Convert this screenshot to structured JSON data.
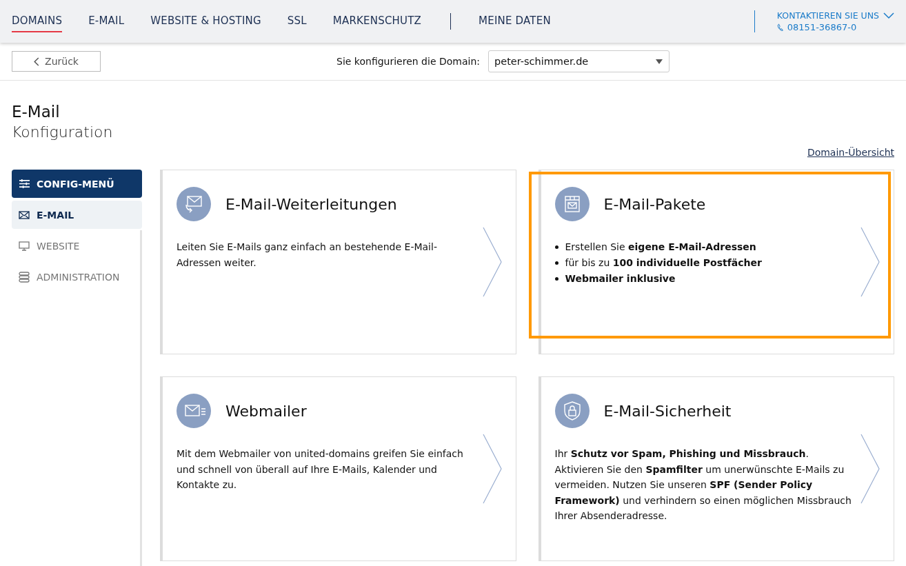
{
  "nav": {
    "items": [
      {
        "label": "DOMAINS",
        "selected": true
      },
      {
        "label": "E-MAIL",
        "selected": false
      },
      {
        "label": "WEBSITE & HOSTING",
        "selected": false
      },
      {
        "label": "SSL",
        "selected": false
      },
      {
        "label": "MARKENSCHUTZ",
        "selected": false
      }
    ],
    "account": "MEINE DATEN",
    "contact": {
      "label": "KONTAKTIEREN SIE UNS",
      "phone": "08151-36867-0"
    }
  },
  "toolbar": {
    "back": "Zurück",
    "domain_label": "Sie konfigurieren die Domain:",
    "domain_value": "peter-schimmer.de"
  },
  "heading": {
    "title": "E-Mail",
    "subtitle": "Konfiguration"
  },
  "overview_link": "Domain-Übersicht",
  "sidebar": {
    "items": [
      {
        "kind": "header",
        "label": "CONFIG-MENÜ"
      },
      {
        "kind": "item",
        "label": "E-MAIL",
        "selected": true
      },
      {
        "kind": "item",
        "label": "WEBSITE",
        "selected": false
      },
      {
        "kind": "item",
        "label": "ADMINISTRATION",
        "selected": false
      }
    ]
  },
  "cards": [
    {
      "title": "E-Mail-Weiterleitungen",
      "highlighted": false,
      "kind": "text",
      "text": "Leiten Sie E-Mails ganz einfach an bestehende E-Mail-Adressen weiter."
    },
    {
      "title": "E-Mail-Pakete",
      "highlighted": true,
      "kind": "bullets",
      "bullets": [
        "Erstellen Sie **eigene E-Mail-Adressen**",
        "für bis zu **100 individuelle Postfächer**",
        "**Webmailer inklusive**"
      ]
    },
    {
      "title": "Webmailer",
      "highlighted": false,
      "kind": "text",
      "text": "Mit dem Webmailer von united-domains greifen Sie einfach und schnell von überall auf Ihre E-Mails, Kalender und Kontakte zu."
    },
    {
      "title": "E-Mail-Sicherheit",
      "highlighted": false,
      "kind": "text",
      "text": "Ihr **Schutz vor Spam, Phishing und Missbrauch**. Aktivieren Sie den **Spamfilter** um unerwünschte E-Mails zu vermeiden. Nutzen Sie unseren **SPF (Sender Policy Framework)** und verhindern so einen möglichen Missbrauch Ihrer Absenderadresse."
    }
  ]
}
